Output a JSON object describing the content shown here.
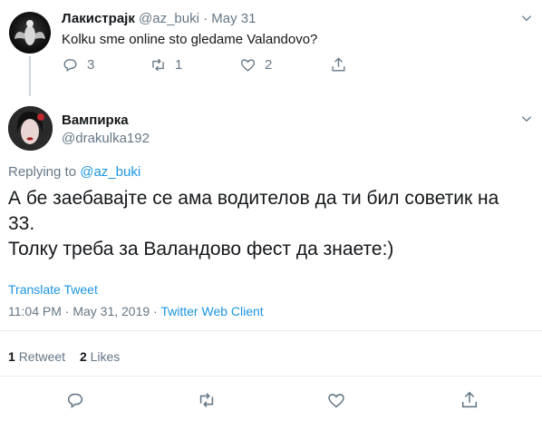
{
  "parent_tweet": {
    "display_name": "Лакистрајк",
    "handle": "@az_buki",
    "separator": "·",
    "date": "May 31",
    "text": "Kolku sme online sto gledame Valandovo?",
    "replies": "3",
    "retweets": "1",
    "likes": "2"
  },
  "main_tweet": {
    "display_name": "Вампирка",
    "handle": "@drakulka192",
    "replying_label": "Replying to ",
    "replying_to": "@az_buki",
    "text_line1": "А бе заебавајте се ама водителов да ти бил советик на",
    "text_line2": "33.",
    "text_line3": "Толку треба за Валандово фест да знаете:)",
    "translate": "Translate Tweet",
    "timestamp": "11:04 PM · May 31, 2019 · ",
    "client": "Twitter Web Client",
    "retweet_count": "1",
    "retweet_label": "Retweet",
    "like_count": "2",
    "like_label": "Likes"
  },
  "icons": [
    "chevron-down-icon",
    "reply-icon",
    "retweet-icon",
    "like-icon",
    "share-icon"
  ],
  "colors": {
    "link": "#1b95e0",
    "muted": "#657786",
    "divider": "#e6ecf0"
  }
}
